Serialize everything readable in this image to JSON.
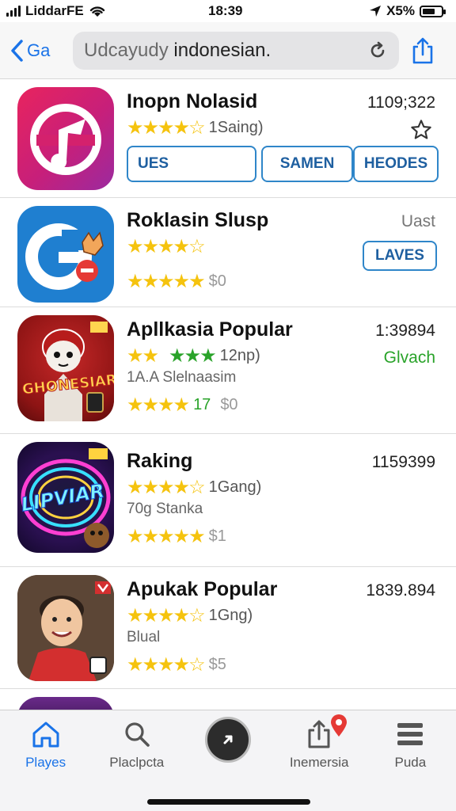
{
  "status_bar": {
    "carrier": "LiddarFE",
    "time": "18:39",
    "battery": "X5%",
    "battery_level": 0.7
  },
  "nav": {
    "back_label": "Ga",
    "search_prefix": "Udcayudy",
    "search_main": " indonesian."
  },
  "apps": [
    {
      "name": "Inopn Nolasid",
      "count": "1109;322",
      "rating_text": "1Saing)",
      "seg1": "UES",
      "seg2": "SAMEN",
      "seg3": "HEODES"
    },
    {
      "name": "Roklasin Slusp",
      "count": "Uast",
      "action": "LAVES",
      "price": "$0"
    },
    {
      "name": "Apllkasia Popular",
      "count": "1:39894",
      "rating_text": "12np)",
      "status": "Glvach",
      "sub": "1A.A Slelnaasim",
      "score": "17",
      "price": "$0"
    },
    {
      "name": "Raking",
      "count": "1159399",
      "rating_text": "1Gang)",
      "sub": "70g Stanka",
      "price": "$1"
    },
    {
      "name": "Apukak Popular",
      "count": "1839.894",
      "rating_text": "1Gng)",
      "sub": "Blual",
      "price": "$5"
    }
  ],
  "tabs": [
    {
      "label": "Playes",
      "icon": "home-icon"
    },
    {
      "label": "Placlpcta",
      "icon": "search-icon"
    },
    {
      "label": "",
      "icon": "play-button-icon"
    },
    {
      "label": "Inemersia",
      "icon": "share-icon"
    },
    {
      "label": "Puda",
      "icon": "menu-icon"
    }
  ],
  "colors": {
    "accent": "#1a73e8",
    "star": "#f5c30e",
    "green": "#2aa32a"
  }
}
